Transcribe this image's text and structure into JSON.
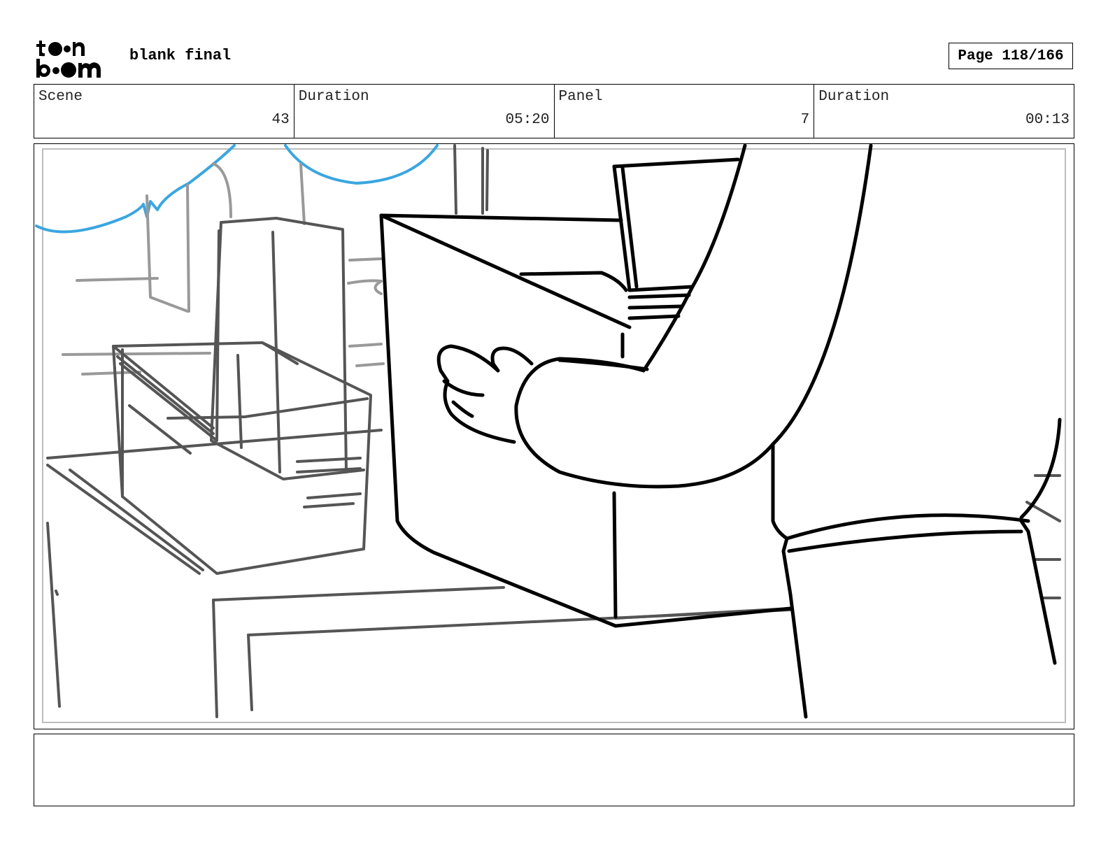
{
  "header": {
    "logo_text": "toon boom",
    "title": "blank final",
    "page_label": "Page 118/166"
  },
  "info": {
    "scene_label": "Scene",
    "scene_value": "43",
    "scene_duration_label": "Duration",
    "scene_duration_value": "05:20",
    "panel_label": "Panel",
    "panel_value": "7",
    "panel_duration_label": "Duration",
    "panel_duration_value": "00:13"
  },
  "panel": {
    "sketch_description": "",
    "colors": {
      "cloud": "#3aa6e0",
      "ink": "#000000",
      "rough": "#555555",
      "light": "#999999"
    }
  },
  "notes": {
    "text": ""
  }
}
